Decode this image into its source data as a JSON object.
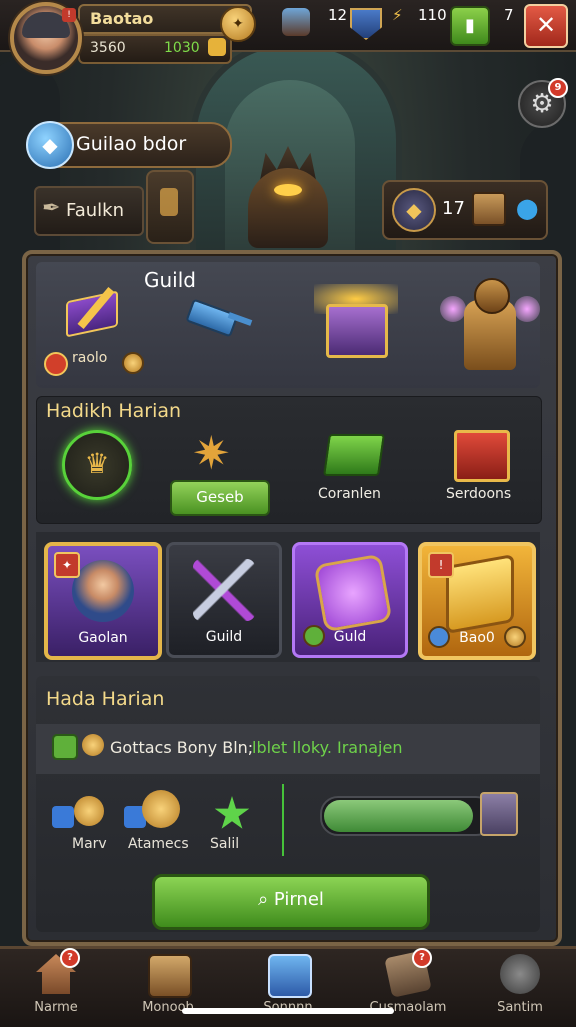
{
  "top_bar": {
    "player_name": "Baotao",
    "level_value": "3560",
    "gold_value": "1030",
    "gem_count": "12",
    "energy_count": "110",
    "ticket_count": "7"
  },
  "guild_header": {
    "title": "Guilao bdor"
  },
  "side_button": {
    "label": "Faulkn"
  },
  "resource_panel": {
    "count": "17"
  },
  "rewards": {
    "title": "Guild",
    "small_label": "raolo"
  },
  "daily": {
    "title": "Hadikh Harian",
    "claim_label": "Geseb",
    "chest_green_label": "Coranlen",
    "chest_red_label": "Serdoons"
  },
  "cards": [
    {
      "label": "Gaolan"
    },
    {
      "label": "Guild"
    },
    {
      "label": "Guld"
    },
    {
      "label": "Bao0"
    }
  ],
  "quest": {
    "title": "Hada Harian",
    "row_text_a": "Gottacs Bony Bln;",
    "row_text_b": "lblet lloky. Iranajen",
    "stats": [
      {
        "label": "Marv"
      },
      {
        "label": "Atamecs"
      },
      {
        "label": "Salil"
      }
    ],
    "progress": 0.9,
    "find_button": "Pirnel"
  },
  "bottom_nav": [
    {
      "label": "Narme",
      "notify": "?"
    },
    {
      "label": "Monoob",
      "notify": ""
    },
    {
      "label": "Sonnnn",
      "notify": ""
    },
    {
      "label": "Cusmaolam",
      "notify": "?"
    },
    {
      "label": "Santim",
      "notify": ""
    }
  ],
  "notifications": {
    "settings_badge": "9"
  }
}
